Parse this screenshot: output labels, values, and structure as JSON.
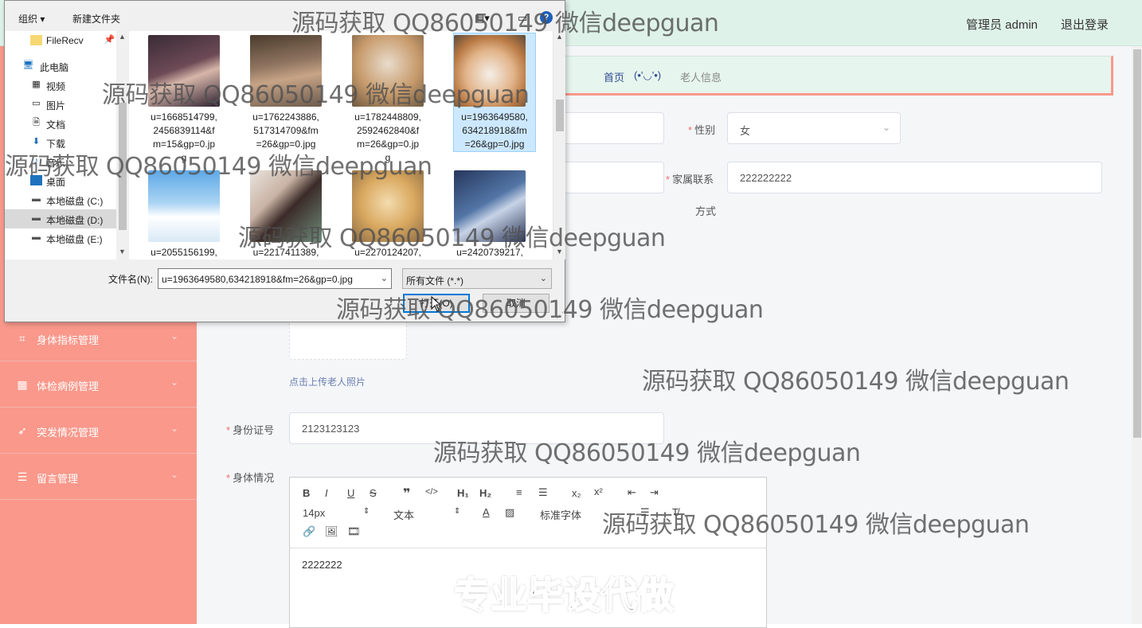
{
  "header": {
    "user": "管理员 admin",
    "logout": "退出登录"
  },
  "breadcrumb": {
    "home": "首页",
    "separator": "(•'◡'•)",
    "current": "老人信息"
  },
  "sidebar": {
    "items": [
      {
        "label": "身体指标管理",
        "icon": "crop-icon"
      },
      {
        "label": "体检病例管理",
        "icon": "grid-icon"
      },
      {
        "label": "突发情况管理",
        "icon": "navigation-icon"
      },
      {
        "label": "留言管理",
        "icon": "list-icon"
      }
    ]
  },
  "form": {
    "gender_label": "性别",
    "gender_value": "女",
    "family_contact_label_line1": "家属联系",
    "family_contact_label_line2": "方式",
    "family_contact_value": "222222222",
    "photo_hint": "点击上传老人照片",
    "id_label": "身份证号",
    "id_value": "2123123123",
    "health_label": "身体情况",
    "editor": {
      "font_size": "14px",
      "text_style": "文本",
      "font_family": "标准字体",
      "content": "2222222"
    }
  },
  "dialog": {
    "organize": "组织",
    "new_folder": "新建文件夹",
    "nav": [
      {
        "label": "FileRecv",
        "icon": "folder-icon"
      },
      {
        "label": "此电脑",
        "icon": "computer-icon"
      },
      {
        "label": "视频",
        "icon": "video-icon"
      },
      {
        "label": "图片",
        "icon": "picture-icon"
      },
      {
        "label": "文档",
        "icon": "document-icon"
      },
      {
        "label": "下载",
        "icon": "download-icon"
      },
      {
        "label": "音乐",
        "icon": "music-icon"
      },
      {
        "label": "桌面",
        "icon": "desktop-icon"
      },
      {
        "label": "本地磁盘 (C:)",
        "icon": "drive-icon"
      },
      {
        "label": "本地磁盘 (D:)",
        "icon": "drive-icon"
      },
      {
        "label": "本地磁盘 (E:)",
        "icon": "drive-icon"
      }
    ],
    "files": [
      {
        "name1": "u=1668514799,",
        "name2": "2456839114&f",
        "name3": "m=15&gp=0.jp",
        "name4": "g"
      },
      {
        "name1": "u=1762243886,",
        "name2": "517314709&fm",
        "name3": "=26&gp=0.jpg",
        "name4": ""
      },
      {
        "name1": "u=1782448809,",
        "name2": "2592462840&f",
        "name3": "m=26&gp=0.jp",
        "name4": "g"
      },
      {
        "name1": "u=1963649580,",
        "name2": "634218918&fm",
        "name3": "=26&gp=0.jpg",
        "name4": ""
      },
      {
        "name1": "u=2055156199,",
        "name2": "",
        "name3": "",
        "name4": ""
      },
      {
        "name1": "u=2217411389,",
        "name2": "",
        "name3": "",
        "name4": ""
      },
      {
        "name1": "u=2270124207,",
        "name2": "",
        "name3": "",
        "name4": ""
      },
      {
        "name1": "u=2420739217,",
        "name2": "",
        "name3": "",
        "name4": ""
      }
    ],
    "filename_label": "文件名(N):",
    "filename_value": "u=1963649580,634218918&fm=26&gp=0.jpg",
    "filetype_value": "所有文件 (*.*)",
    "open_button": "打开(O)",
    "cancel_button": "取消"
  },
  "watermarks": {
    "text": "源码获取 QQ86050149 微信deepguan",
    "stamp": "专业毕设代做"
  },
  "colors": {
    "sidebar": "#f9988b",
    "header": "#dff2ea",
    "required": "#f56c6c",
    "dialog_selection": "#cce8ff"
  }
}
